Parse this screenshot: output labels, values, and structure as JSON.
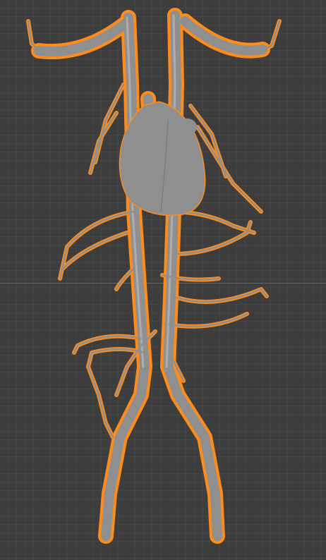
{
  "viewport": {
    "background_color": "#3d3d3d",
    "x_axis_color": "#b34a4a"
  },
  "model": {
    "description_icon": "vascular-anatomy-mesh",
    "mesh_color": "#8f8f8f",
    "mesh_highlight": "#b9b9b9",
    "selection_outline_color": "#ff8c1a",
    "selected": true
  }
}
